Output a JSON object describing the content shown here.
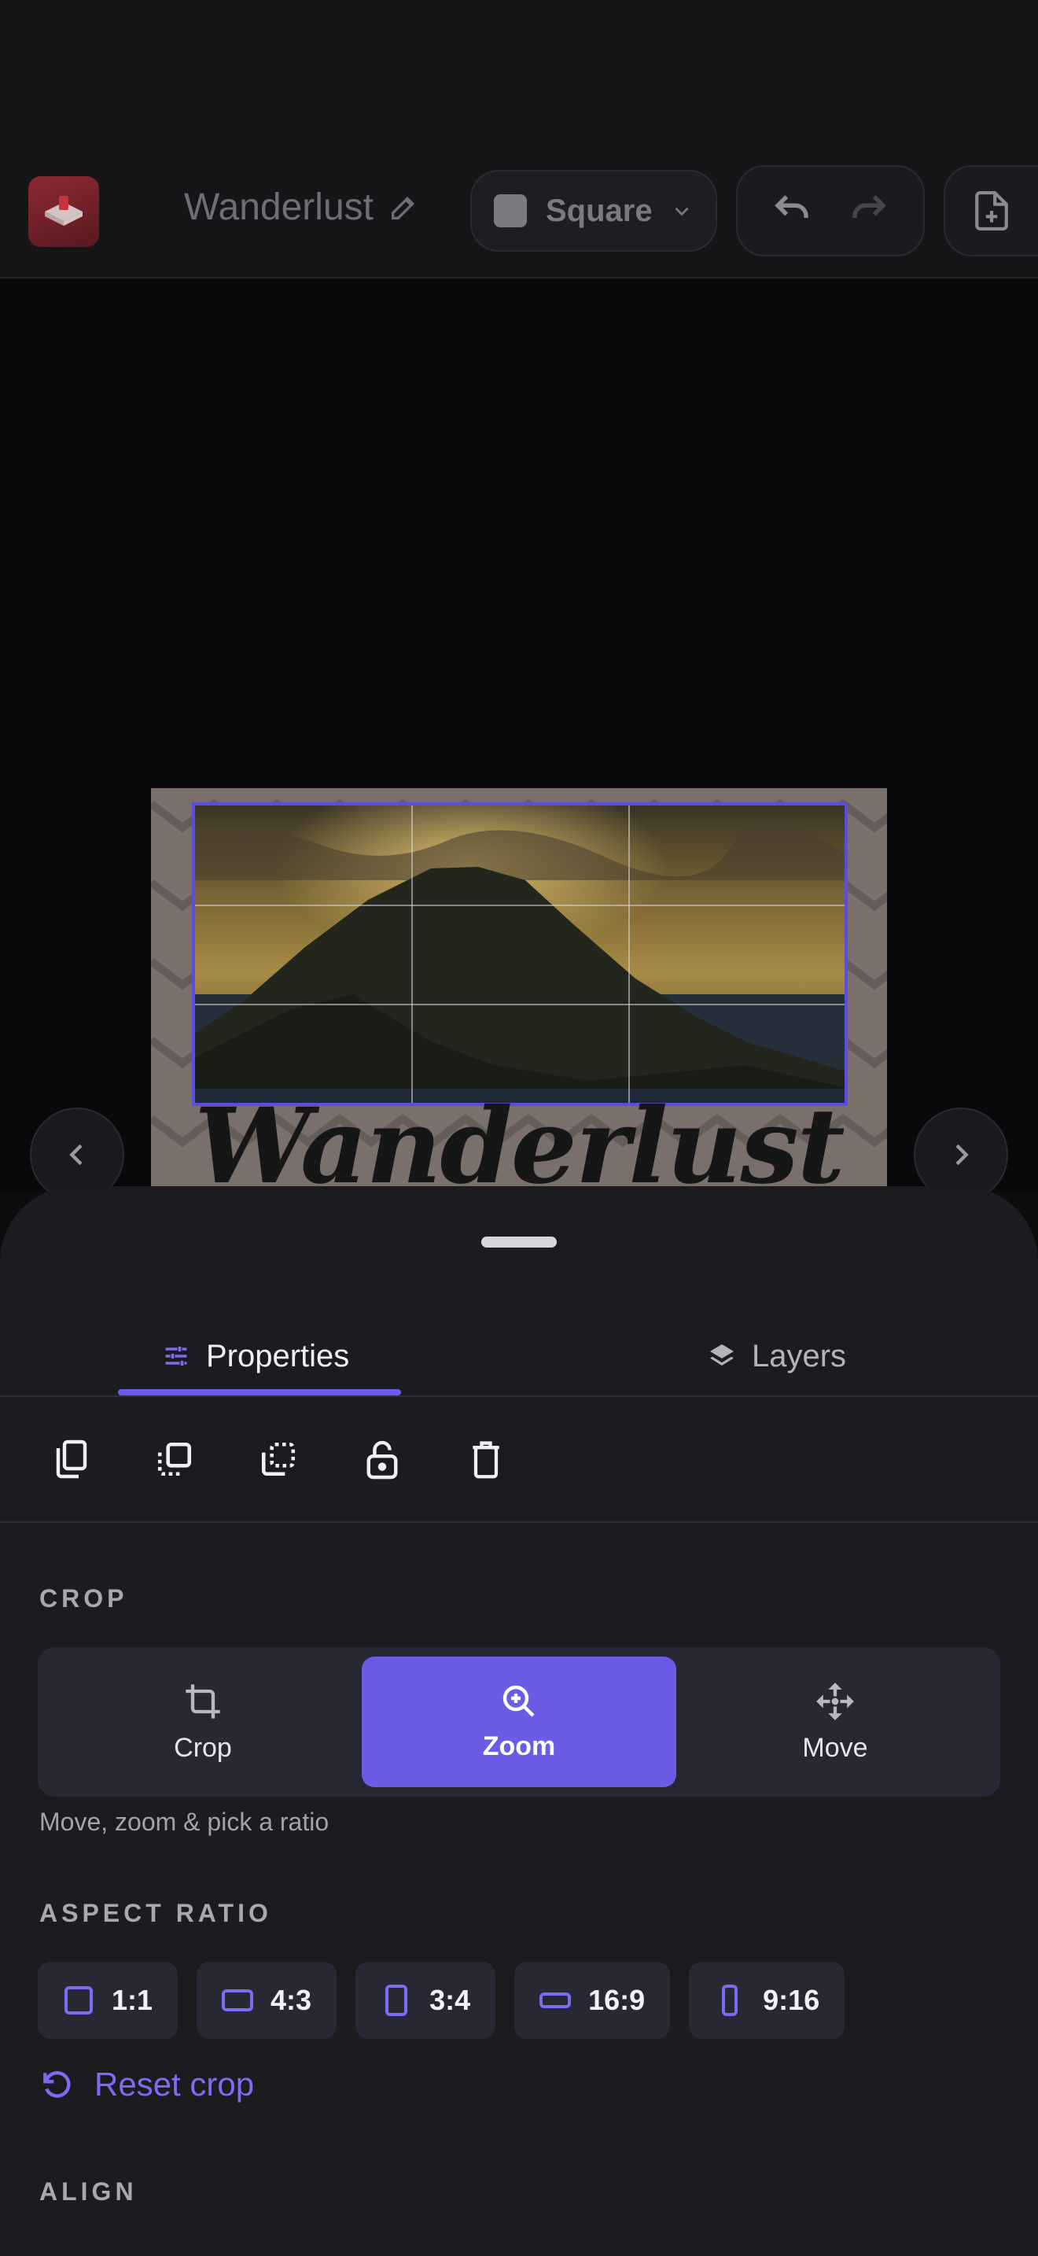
{
  "app": {
    "doc_title": "Wanderlust",
    "canvas_size_label": "Square",
    "icons": {
      "app": "app-logo-icon",
      "edit": "pencil-icon",
      "undo": "undo-icon",
      "redo": "redo-icon",
      "export": "file-plus-icon"
    }
  },
  "canvas": {
    "design_title": "Wanderlust",
    "prev_icon": "chevron-left-icon",
    "next_icon": "chevron-right-icon"
  },
  "sheet": {
    "tabs": [
      {
        "label": "Properties",
        "icon": "sliders-icon",
        "active": true
      },
      {
        "label": "Layers",
        "icon": "layers-icon",
        "active": false
      }
    ],
    "tools": [
      "duplicate-icon",
      "bring-forward-icon",
      "send-backward-icon",
      "unlock-icon",
      "delete-icon"
    ],
    "crop": {
      "section_label": "CROP",
      "modes": [
        {
          "label": "Crop",
          "icon": "crop-icon",
          "active": false
        },
        {
          "label": "Zoom",
          "icon": "zoom-in-icon",
          "active": true
        },
        {
          "label": "Move",
          "icon": "move-icon",
          "active": false
        }
      ],
      "hint": "Move, zoom & pick a ratio"
    },
    "aspect": {
      "section_label": "ASPECT RATIO",
      "options": [
        "1:1",
        "4:3",
        "3:4",
        "16:9",
        "9:16"
      ],
      "reset_label": "Reset crop"
    },
    "align": {
      "section_label": "ALIGN"
    }
  },
  "colors": {
    "accent": "#6b5ce6",
    "background": "#0c0c0f",
    "sheet": "#1b1b20"
  }
}
